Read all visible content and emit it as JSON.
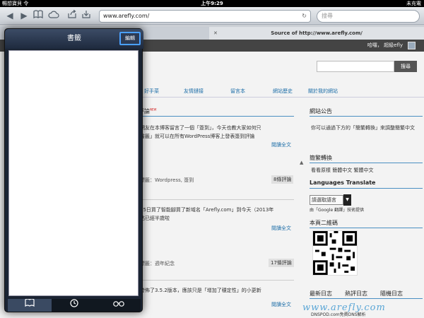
{
  "status": {
    "carrier": "暢想寶貝 令",
    "time": "上午9:29",
    "battery": "未充電"
  },
  "toolbar": {
    "url": "www.arefly.com/",
    "search_placeholder": "搜尋"
  },
  "tabs": [
    {
      "label": ""
    },
    {
      "label": "Source of http://www.arefly.com/"
    }
  ],
  "site": {
    "user_links": "哈囉， 超級efly",
    "search_button": "搜尋",
    "nav": [
      "好手菜",
      "友情鏈接",
      "留言本",
      "網站歷史",
      "關於我的網站"
    ],
    "posts": [
      {
        "title": "評論",
        "badge": "NEW"
      },
      {
        "line1": "網友在本博客留言了一個「簽到」，今天也教大家如何只",
        "line2": "書籤」就可以在所有WordPress博客上發表簽到評論",
        "readmore": "閱讀全文",
        "meta": "標籤：Wordpress, 簽到",
        "count": "8條評論"
      },
      {
        "line1": "25日買了智能腳買了新域名「Arefly.com」到今天（2013年",
        "line2": "站已經半歲啦",
        "readmore": "閱讀全文",
        "meta": "標籤：週年紀念",
        "count": "17條評論"
      },
      {
        "line1": "發佈了3.5.2版本，應該只是「增加了穩定性」的小更新",
        "readmore": "閱讀全文"
      }
    ],
    "sidebar": {
      "announce_title": "網站公告",
      "announce_text": "你可以通過下方的「簡繁轉換」來調整簡繁中文",
      "convert_title": "簡繁轉換",
      "convert_links": "看看原樣 簡體中文 繁體中文",
      "translate_title": "Languages Translate",
      "translate_select": "請選取語言",
      "translate_powered": "由「Google 翻譯」技術提供",
      "qr_title": "本頁二維碼",
      "tabs": [
        "最新日志",
        "熱評日志",
        "隨機日志"
      ],
      "tabs_bottom": "DNSPOD.com免費DNS解析"
    },
    "watermark": "www.arefly.com"
  },
  "bookmarks": {
    "title": "書籤",
    "edit_label": "編輯",
    "tabs": [
      "bookmarks-icon",
      "history-icon",
      "reading-list-icon"
    ]
  },
  "colors": {
    "accent": "#4aa0ff",
    "link": "#1d6ea8",
    "highlight": "#d01010"
  }
}
